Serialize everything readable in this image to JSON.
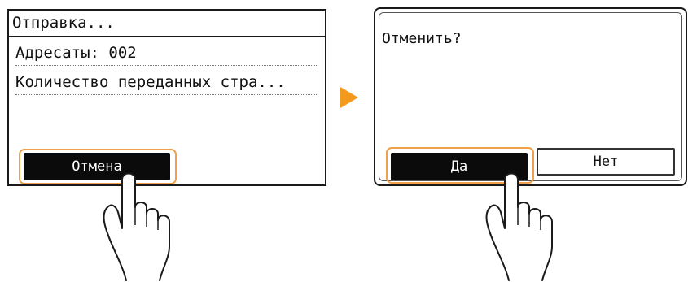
{
  "screen_sending": {
    "title": "Отправка...",
    "recipients": "Адресаты: 002",
    "pages_sent": "Количество переданных стра...",
    "cancel_button": "Отмена"
  },
  "screen_confirm": {
    "question": "Отменить?",
    "yes_button": "Да",
    "no_button": "Нет"
  },
  "colors": {
    "highlight": "#f0a04a",
    "arrow": "#f39a1d",
    "button_dark": "#0b0b0b"
  },
  "icons": {
    "arrow": "next-step-arrow-icon",
    "hand": "tapping-hand-icon"
  }
}
